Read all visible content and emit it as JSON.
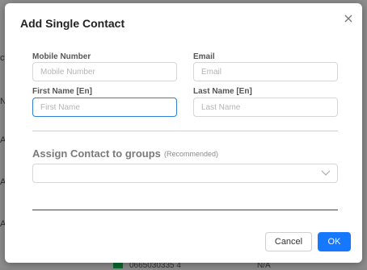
{
  "background": {
    "side_letters": [
      "ct",
      "N",
      "A",
      "A",
      "A"
    ],
    "row": {
      "phone": "0665030335 4",
      "status": "N/A"
    }
  },
  "modal": {
    "title": "Add Single Contact",
    "close_icon": "close-icon",
    "fields": {
      "mobile": {
        "label": "Mobile Number",
        "placeholder": "Mobile Number",
        "value": ""
      },
      "email": {
        "label": "Email",
        "placeholder": "Email",
        "value": ""
      },
      "first_name": {
        "label": "First Name [En]",
        "placeholder": "First Name",
        "value": ""
      },
      "last_name": {
        "label": "Last Name [En]",
        "placeholder": "Last Name",
        "value": ""
      }
    },
    "groups": {
      "title": "Assign Contact to groups",
      "note": "(Recommended)",
      "selected": ""
    },
    "buttons": {
      "cancel": "Cancel",
      "ok": "OK"
    }
  },
  "colors": {
    "primary": "#1677ff",
    "focus_border": "#2e7fd6",
    "backdrop": "#8d8d8d"
  }
}
